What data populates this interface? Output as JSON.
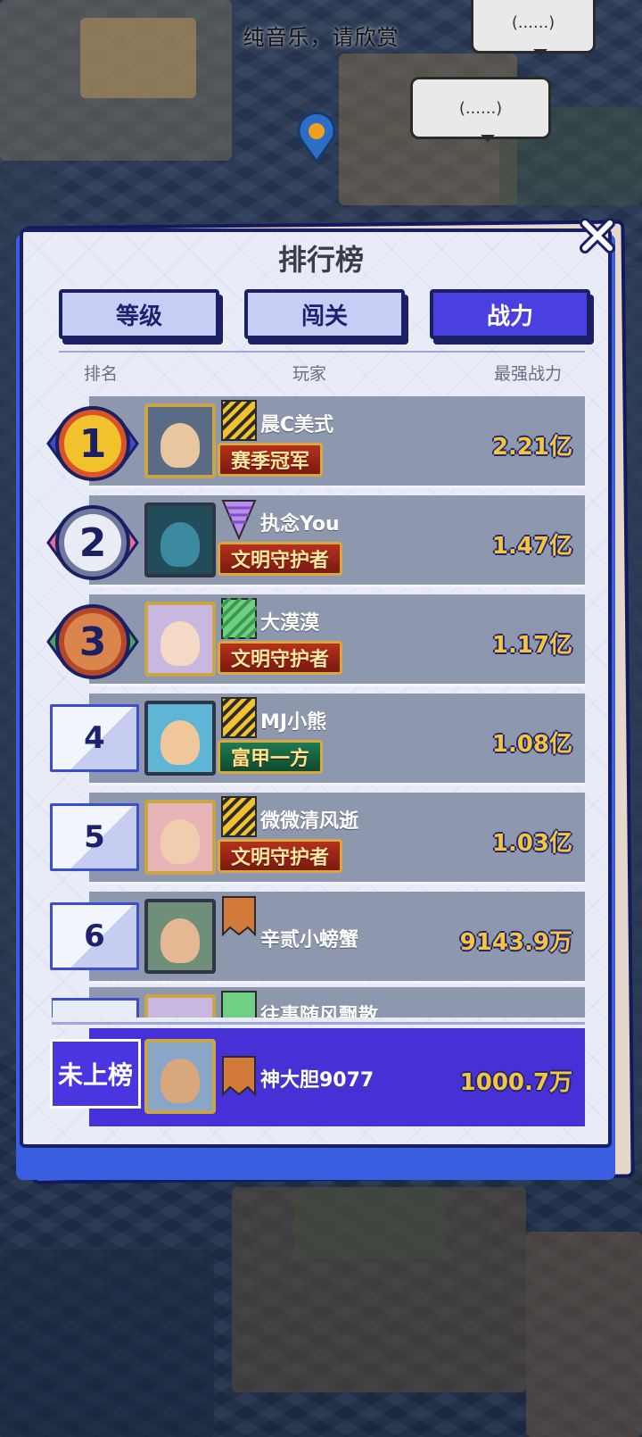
{
  "subtitle": "纯音乐，请欣赏",
  "bubbles": [
    "(......)",
    "(......)"
  ],
  "panel": {
    "title": "排行榜",
    "tabs": [
      {
        "label": "等级",
        "active": false
      },
      {
        "label": "闯关",
        "active": false
      },
      {
        "label": "战力",
        "active": true
      }
    ],
    "headers": {
      "rank": "排名",
      "player": "玩家",
      "power": "最强战力"
    }
  },
  "rows": [
    {
      "rank": "1",
      "name": "晨C美式",
      "title": "赛季冠军",
      "power": "2.21亿",
      "flag": "yellow-stripe",
      "badge_color": "#f2c12e"
    },
    {
      "rank": "2",
      "name": "执念You",
      "title": "文明守护者",
      "power": "1.47亿",
      "flag": "purple-triangle",
      "badge_color": "#9aa3c0"
    },
    {
      "rank": "3",
      "name": "大漠漠",
      "title": "文明守护者",
      "power": "1.17亿",
      "flag": "green-stripe",
      "badge_color": "#d9854c"
    },
    {
      "rank": "4",
      "name": "MJ小熊",
      "title": "富甲一方",
      "power": "1.08亿",
      "flag": "yellow-stripe"
    },
    {
      "rank": "5",
      "name": "微微清风逝",
      "title": "文明守护者",
      "power": "1.03亿",
      "flag": "yellow-stripe"
    },
    {
      "rank": "6",
      "name": "辛贰小螃蟹",
      "title": "",
      "power": "9143.9万",
      "flag": "orange-pennant"
    },
    {
      "rank": "",
      "name": "往事随风飘散",
      "title": "",
      "power": "",
      "flag": "green-stripe"
    }
  ],
  "me": {
    "rank_label": "未上榜",
    "name": "神大胆9077",
    "power": "1000.7万",
    "flag": "orange-pennant"
  },
  "colors": {
    "accent": "#4b3fe0",
    "power_text": "#f5c542",
    "row_bg": "#8d97ad",
    "frame": "#1b1f63"
  }
}
